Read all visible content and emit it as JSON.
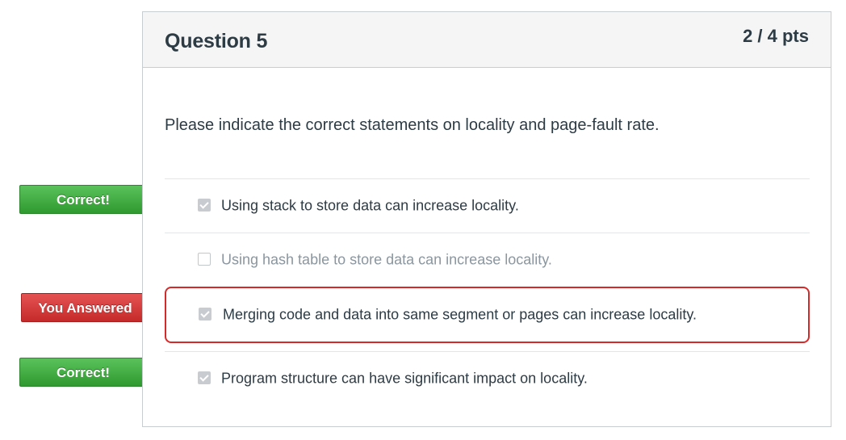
{
  "question": {
    "title": "Question 5",
    "points": "2 / 4 pts",
    "text": "Please indicate the correct statements on locality and page-fault rate."
  },
  "answers": [
    {
      "text": "Using stack to store data can increase locality.",
      "checked": true,
      "flag": "Correct!"
    },
    {
      "text": "Using hash table to store data can increase locality.",
      "checked": false,
      "flag": ""
    },
    {
      "text": "Merging code and data into same segment or pages can increase locality.",
      "checked": true,
      "flag": "You Answered"
    },
    {
      "text": "Program structure can have significant impact on locality.",
      "checked": true,
      "flag": "Correct!"
    }
  ],
  "colors": {
    "correct_flag": "#3aa63a",
    "you_answered_flag": "#d33a3a",
    "wrong_border": "#d52a2a",
    "header_bg": "#f5f5f5"
  }
}
